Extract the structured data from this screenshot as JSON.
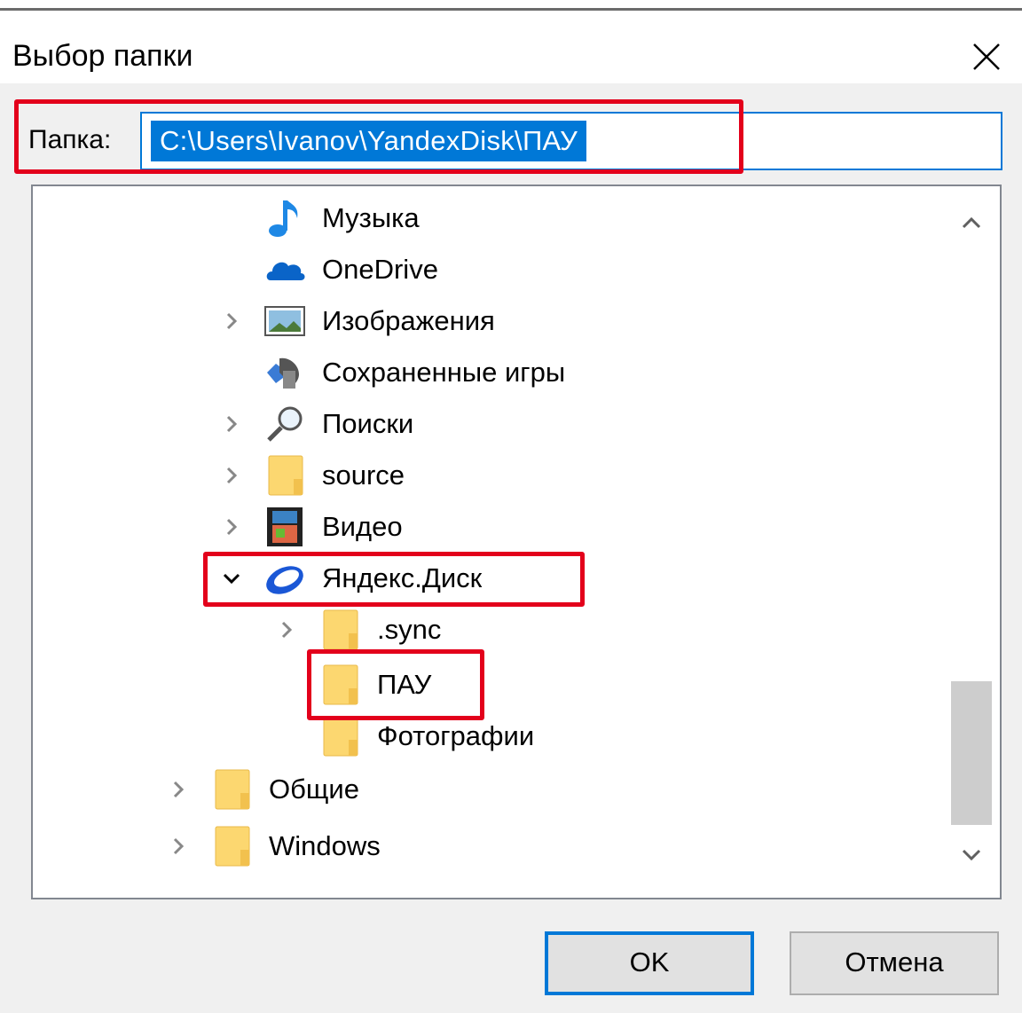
{
  "dialog": {
    "title": "Выбор папки"
  },
  "path": {
    "label": "Папка:",
    "value": "C:\\Users\\Ivanov\\YandexDisk\\ПАУ"
  },
  "tree": {
    "items": [
      {
        "label": "Музыка",
        "icon": "music-icon",
        "expander": "none",
        "level": 2
      },
      {
        "label": "OneDrive",
        "icon": "onedrive-icon",
        "expander": "none",
        "level": 2
      },
      {
        "label": "Изображения",
        "icon": "pictures-icon",
        "expander": "collapsed",
        "level": 2
      },
      {
        "label": "Сохраненные игры",
        "icon": "saved-games-icon",
        "expander": "none",
        "level": 2
      },
      {
        "label": "Поиски",
        "icon": "search-icon",
        "expander": "collapsed",
        "level": 2
      },
      {
        "label": "source",
        "icon": "folder-icon",
        "expander": "collapsed",
        "level": 2
      },
      {
        "label": "Видео",
        "icon": "video-icon",
        "expander": "collapsed",
        "level": 2
      },
      {
        "label": "Яндекс.Диск",
        "icon": "yandex-disk-icon",
        "expander": "expanded",
        "level": 2
      },
      {
        "label": ".sync",
        "icon": "folder-icon",
        "expander": "collapsed",
        "level": 3
      },
      {
        "label": "ПАУ",
        "icon": "folder-icon",
        "expander": "none",
        "level": 3,
        "selected": true
      },
      {
        "label": "Фотографии",
        "icon": "folder-icon",
        "expander": "none",
        "level": 3
      },
      {
        "label": "Общие",
        "icon": "folder-icon",
        "expander": "collapsed",
        "level": 1
      },
      {
        "label": "Windows",
        "icon": "folder-icon",
        "expander": "collapsed",
        "level": 1
      }
    ]
  },
  "buttons": {
    "ok": "OK",
    "cancel": "Отмена"
  },
  "colors": {
    "accent": "#0078d7",
    "highlight": "#e3001b",
    "folder": "#fcd770"
  }
}
